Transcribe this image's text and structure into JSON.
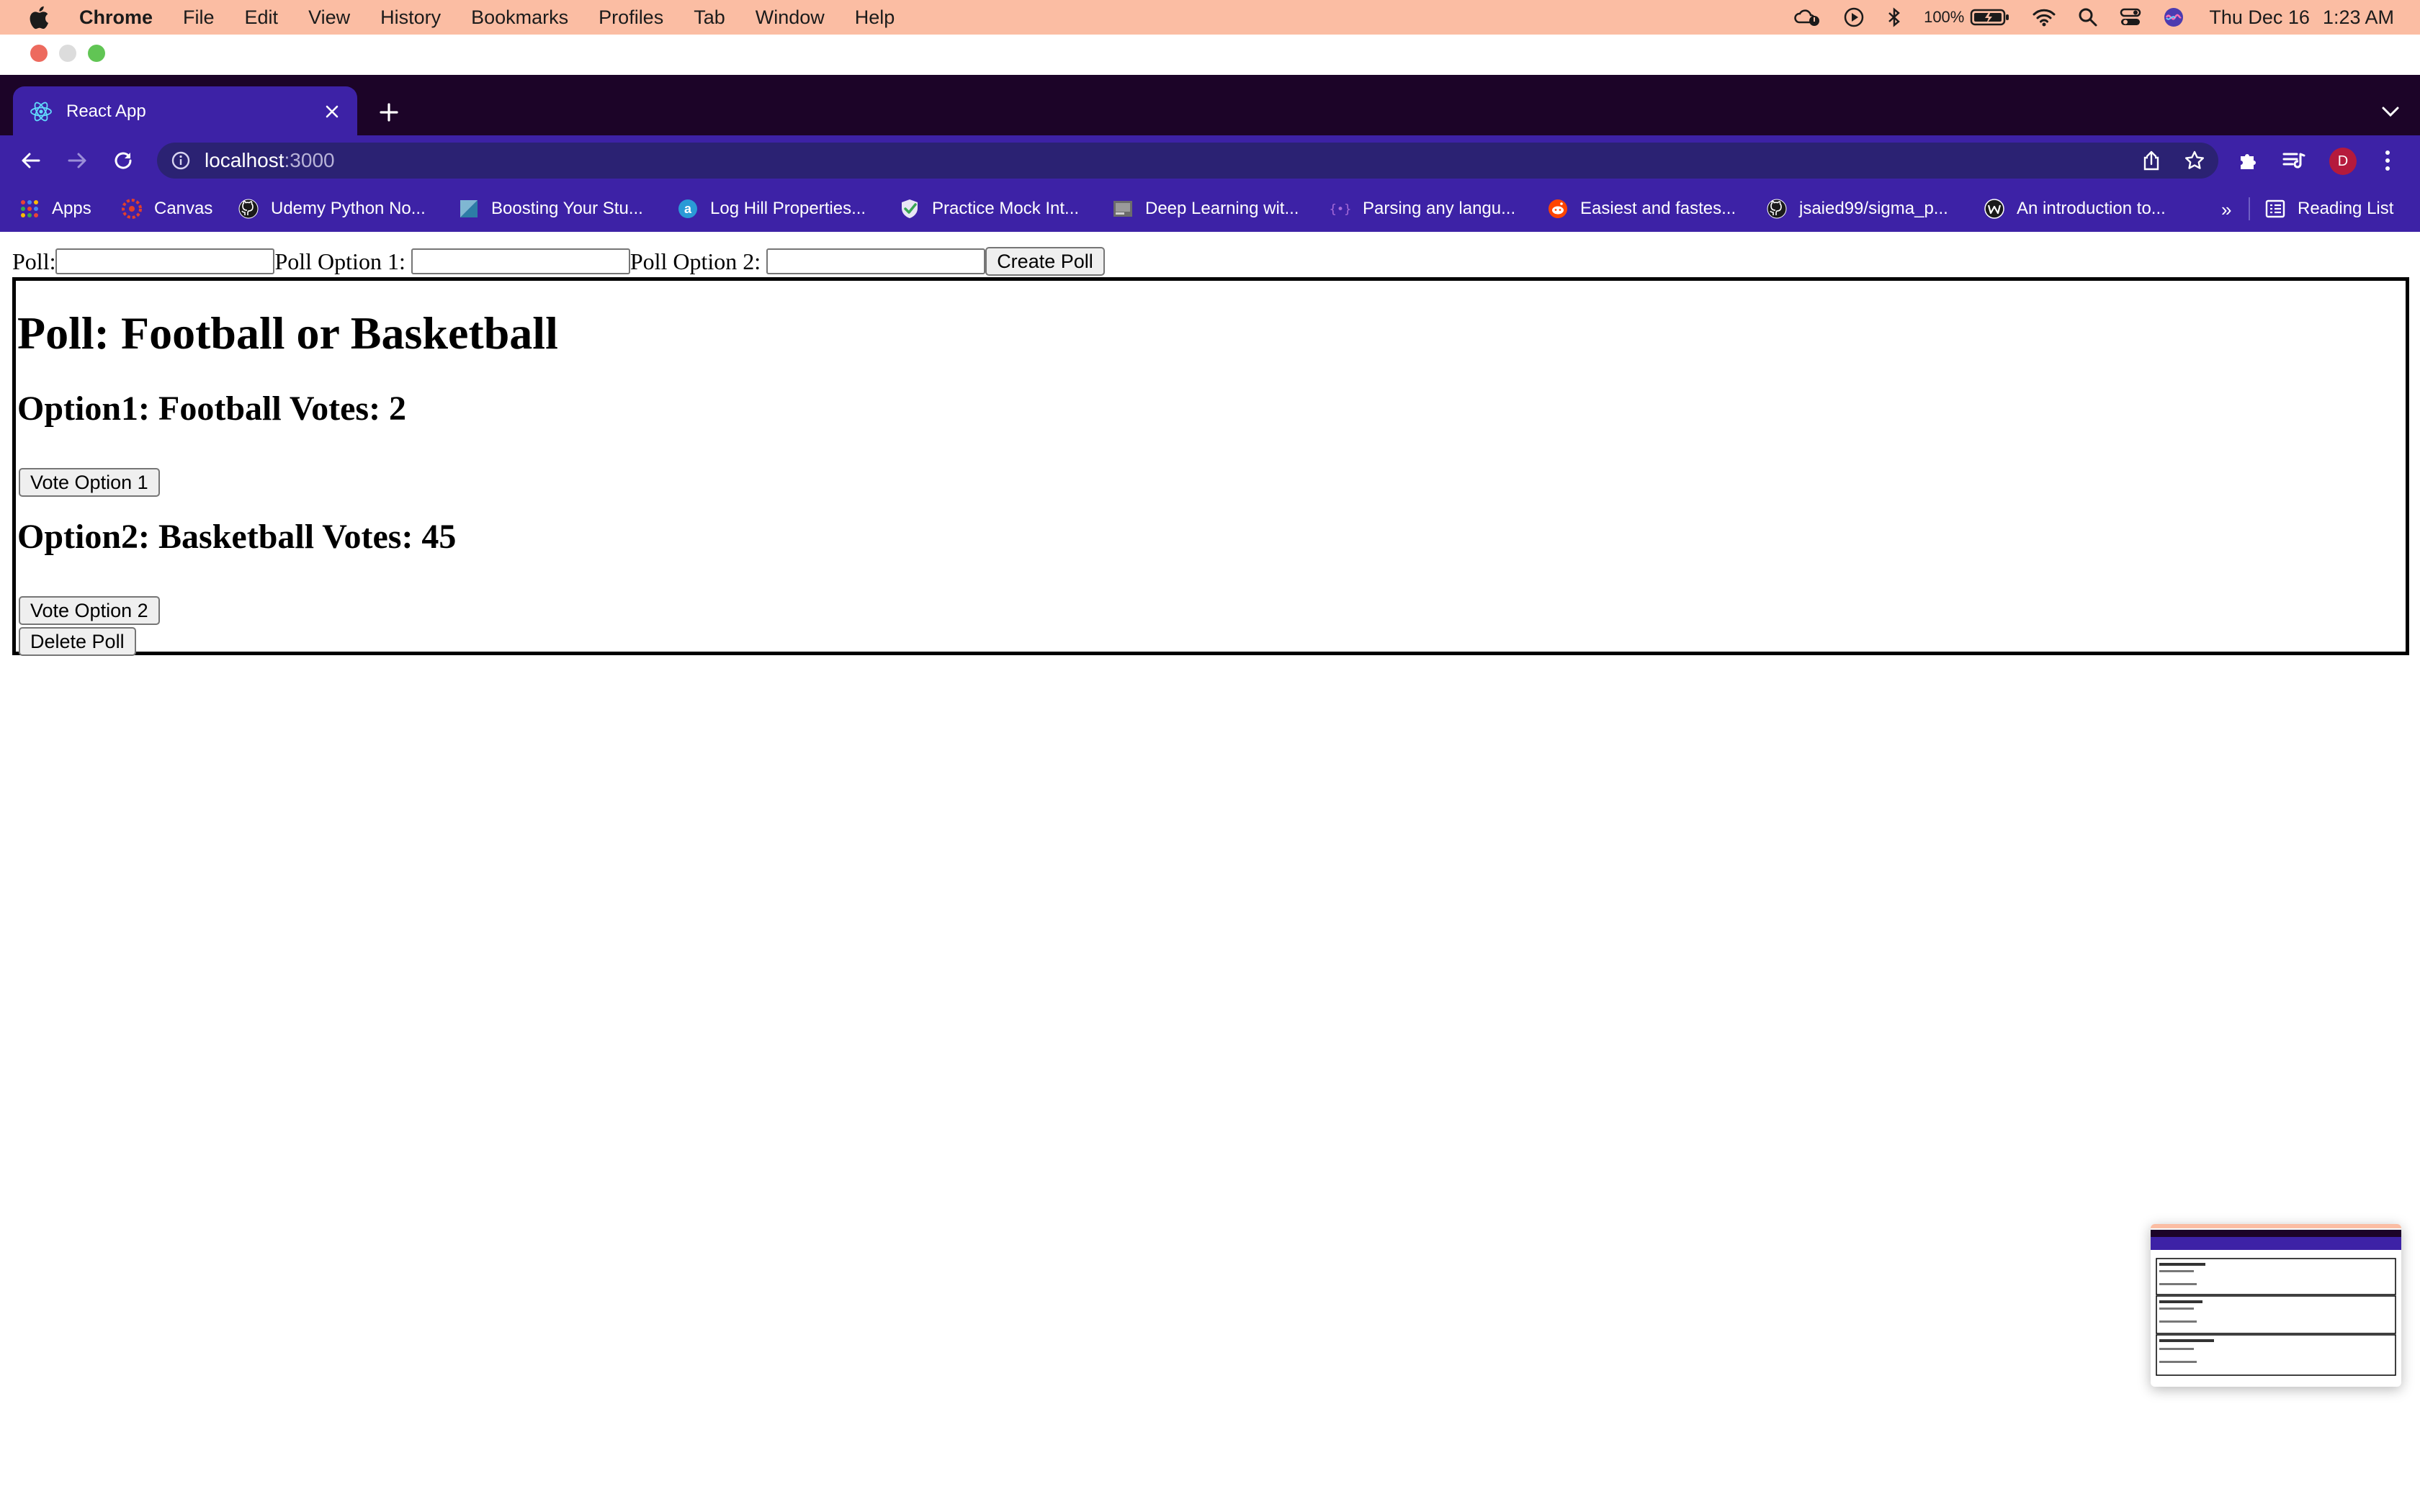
{
  "menubar": {
    "app_name": "Chrome",
    "menus": [
      "File",
      "Edit",
      "View",
      "History",
      "Bookmarks",
      "Profiles",
      "Tab",
      "Window",
      "Help"
    ],
    "battery_percent": "100%",
    "date": "Thu Dec 16",
    "time": "1:23 AM",
    "bg_color": "#fbbda3"
  },
  "browser": {
    "tab_title": "React App",
    "url_host": "localhost",
    "url_port": ":3000",
    "profile_initial": "D",
    "theme_color": "#3d22a6"
  },
  "bookmarks": {
    "items": [
      {
        "label": "Apps",
        "icon": "apps-grid-icon"
      },
      {
        "label": "Canvas",
        "icon": "canvas-icon"
      },
      {
        "label": "Udemy Python No...",
        "icon": "github-icon"
      },
      {
        "label": "Boosting Your Stu...",
        "icon": "page-icon"
      },
      {
        "label": "Log Hill Properties...",
        "icon": "a-logo-icon"
      },
      {
        "label": "Practice Mock Int...",
        "icon": "check-shield-icon"
      },
      {
        "label": "Deep Learning wit...",
        "icon": "image-thumb-icon"
      },
      {
        "label": "Parsing any langu...",
        "icon": "brackets-icon"
      },
      {
        "label": "Easiest and fastes...",
        "icon": "reddit-icon"
      },
      {
        "label": "jsaied99/sigma_p...",
        "icon": "github-icon"
      },
      {
        "label": "An introduction to...",
        "icon": "w-logo-icon"
      }
    ],
    "overflow": "»",
    "reading_list": "Reading List"
  },
  "form": {
    "poll_label": "Poll:",
    "option1_label": "Poll Option 1:",
    "option2_label": "Poll Option 2:",
    "poll_value": "",
    "option1_value": "",
    "option2_value": "",
    "create_button": "Create Poll"
  },
  "poll": {
    "title": "Poll: Football or Basketball",
    "option1_text": "Option1: Football Votes: 2",
    "option1_votes": 2,
    "vote1_button": "Vote Option 1",
    "option2_text": "Option2: Basketball Votes: 45",
    "option2_votes": 45,
    "vote2_button": "Vote Option 2",
    "delete_button": "Delete Poll"
  }
}
